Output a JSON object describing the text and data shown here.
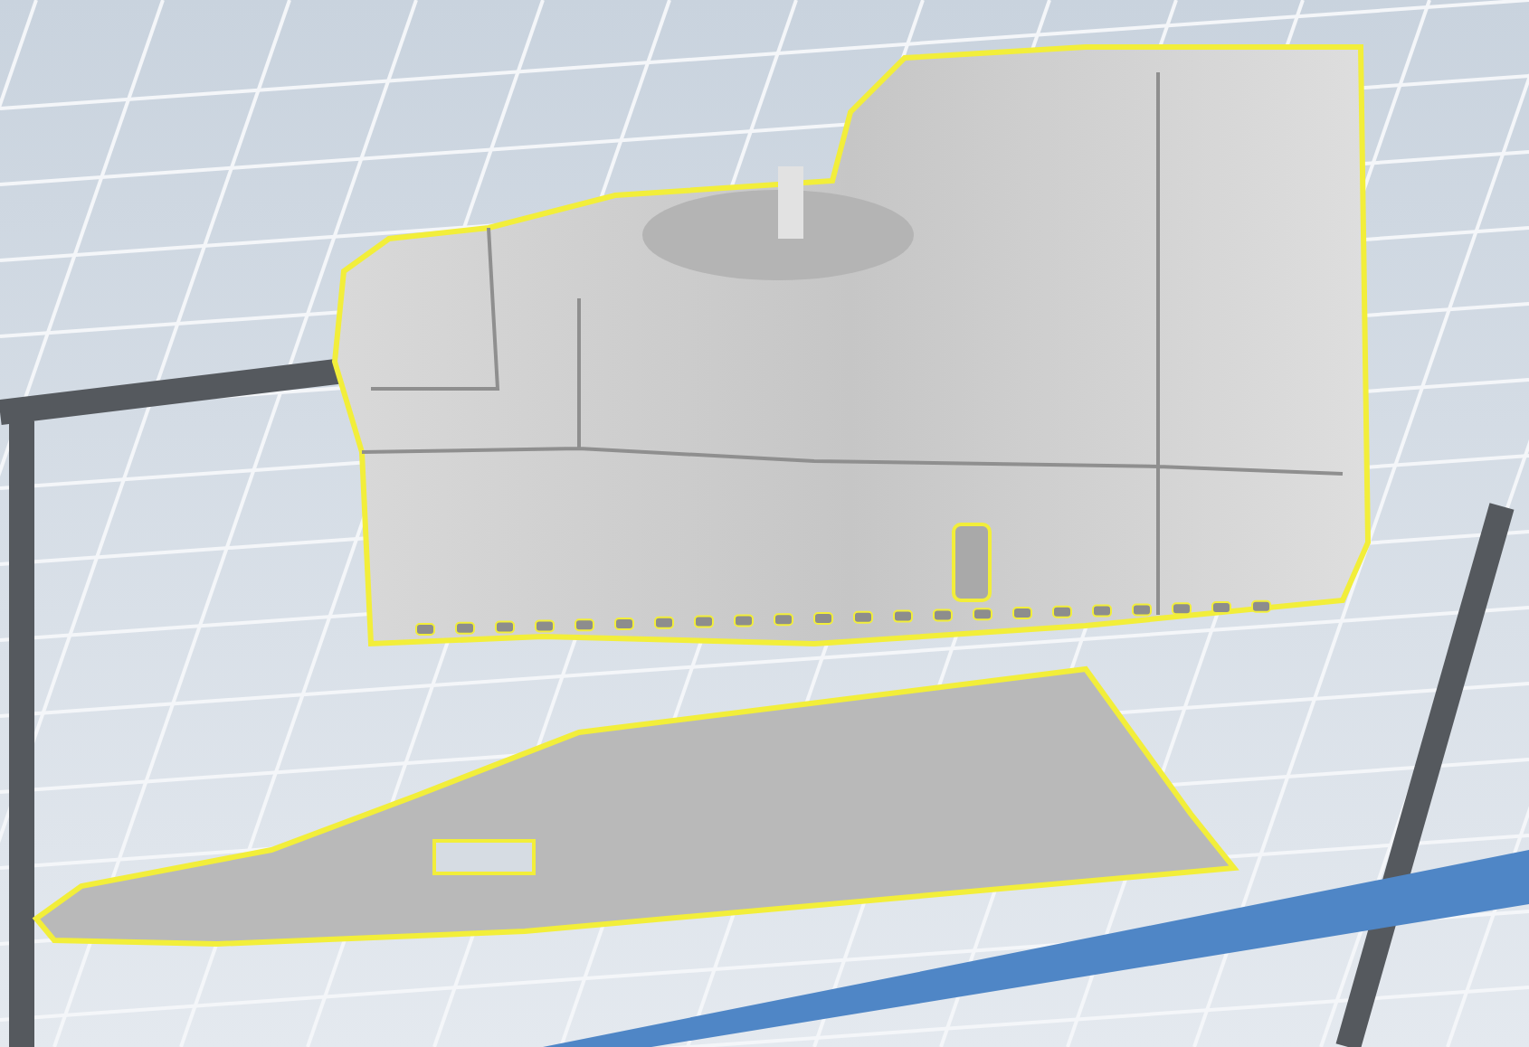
{
  "scene": {
    "objects": [
      {
        "kind": "housing",
        "selected": true
      },
      {
        "kind": "plate",
        "selected": true
      }
    ]
  }
}
